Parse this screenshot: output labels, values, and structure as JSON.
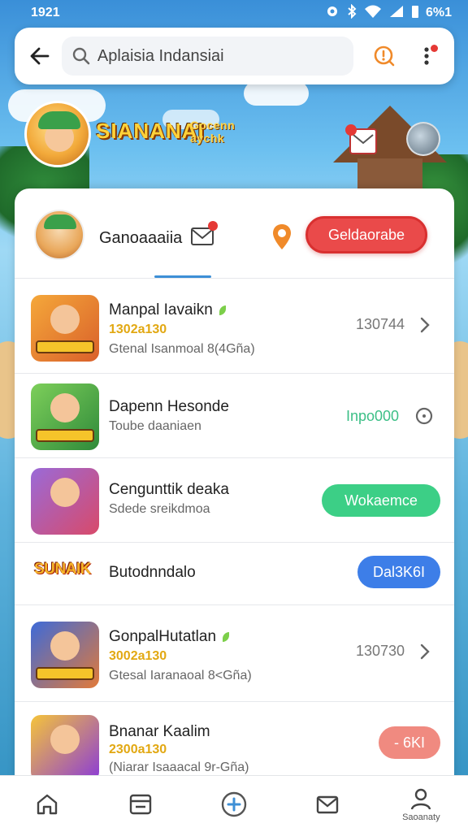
{
  "status_bar": {
    "time": "1921",
    "battery": "6%1"
  },
  "search": {
    "value": "Aplaisia Indansiai"
  },
  "hero": {
    "subtitle": "Gocenn aychk",
    "title": "SIANANAI"
  },
  "profile": {
    "name": "Ganoaaaiia",
    "action_label": "Geldaorabe"
  },
  "list": [
    {
      "title": "Manpal Iavaikn",
      "gold": "1302a130",
      "subtitle": "Gtenal Isanmoal 8(4Gña)",
      "stat": "130744"
    },
    {
      "title": "Dapenn Hesonde",
      "subtitle": "Toube daaniaen",
      "stat": "Inpo000"
    },
    {
      "title": "Cengunttik deaka",
      "subtitle": "Sdede sreikdmoa",
      "action": "Wokaemce"
    },
    {
      "logo_text": "SUNAIK",
      "title": "Butodnndalo",
      "action": "Dal3K6I"
    },
    {
      "title": "GonpalHutatlan",
      "gold": "3002a130",
      "subtitle": "Gtesal Iaranaoal 8<Gña)",
      "stat": "130730"
    },
    {
      "title": "Bnanar Kaalim",
      "gold": "2300a130",
      "subtitle": "(Niarar Isaaacal 9r-Gña)",
      "action": "- 6KI"
    }
  ],
  "bottom_nav": {
    "profile_label": "Saoanaty"
  },
  "colors": {
    "accent": "#3d8fd6",
    "red": "#ea4a4a",
    "green": "#3ccf86",
    "blue": "#3d7ee8",
    "salmon": "#f08a80"
  }
}
